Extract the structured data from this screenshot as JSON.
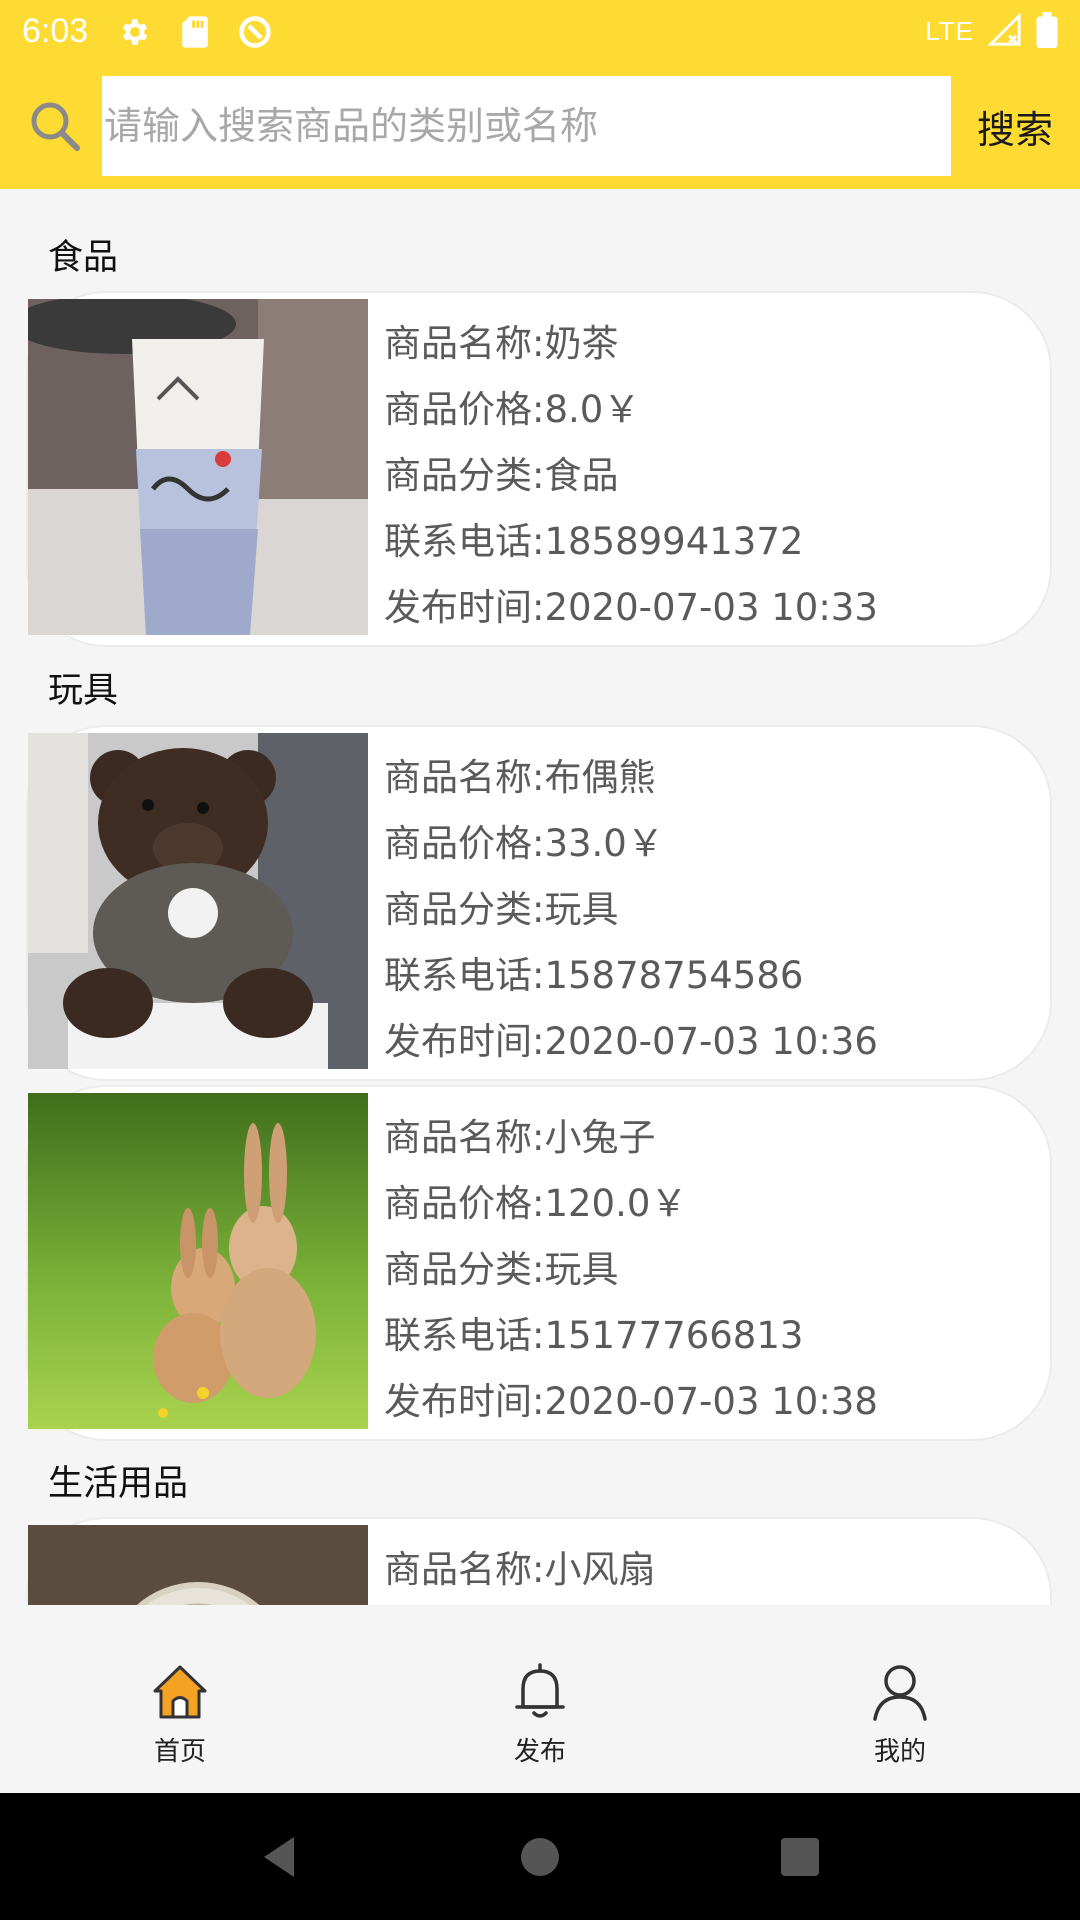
{
  "status_bar": {
    "time": "6:03",
    "network": "LTE",
    "icons": [
      "gear-icon",
      "sd-card-icon",
      "sync-icon",
      "signal-icon",
      "battery-icon"
    ]
  },
  "search": {
    "placeholder": "请输入搜索商品的类别或名称",
    "value": "",
    "button_label": "搜索",
    "icon": "search-icon"
  },
  "colors": {
    "accent": "#fddb33",
    "home_icon": "#f4a223"
  },
  "sections": [
    {
      "title": "食品",
      "items": [
        {
          "name": "商品名称:奶茶",
          "price": "商品价格:8.0￥",
          "category": "商品分类:食品",
          "phone": "联系电话:18589941372",
          "time": "发布时间:2020-07-03 10:33"
        }
      ]
    },
    {
      "title": "玩具",
      "items": [
        {
          "name": "商品名称:布偶熊",
          "price": "商品价格:33.0￥",
          "category": "商品分类:玩具",
          "phone": "联系电话:15878754586",
          "time": "发布时间:2020-07-03 10:36"
        },
        {
          "name": "商品名称:小兔子",
          "price": "商品价格:120.0￥",
          "category": "商品分类:玩具",
          "phone": "联系电话:15177766813",
          "time": "发布时间:2020-07-03 10:38"
        }
      ]
    },
    {
      "title": "生活用品",
      "items": [
        {
          "name": "商品名称:小风扇"
        }
      ]
    }
  ],
  "bottom_nav": {
    "items": [
      {
        "label": "首页",
        "icon": "home-icon",
        "active": true
      },
      {
        "label": "发布",
        "icon": "bell-icon",
        "active": false
      },
      {
        "label": "我的",
        "icon": "person-icon",
        "active": false
      }
    ]
  },
  "android_nav": [
    "back-icon",
    "home-circle-icon",
    "recents-icon"
  ]
}
